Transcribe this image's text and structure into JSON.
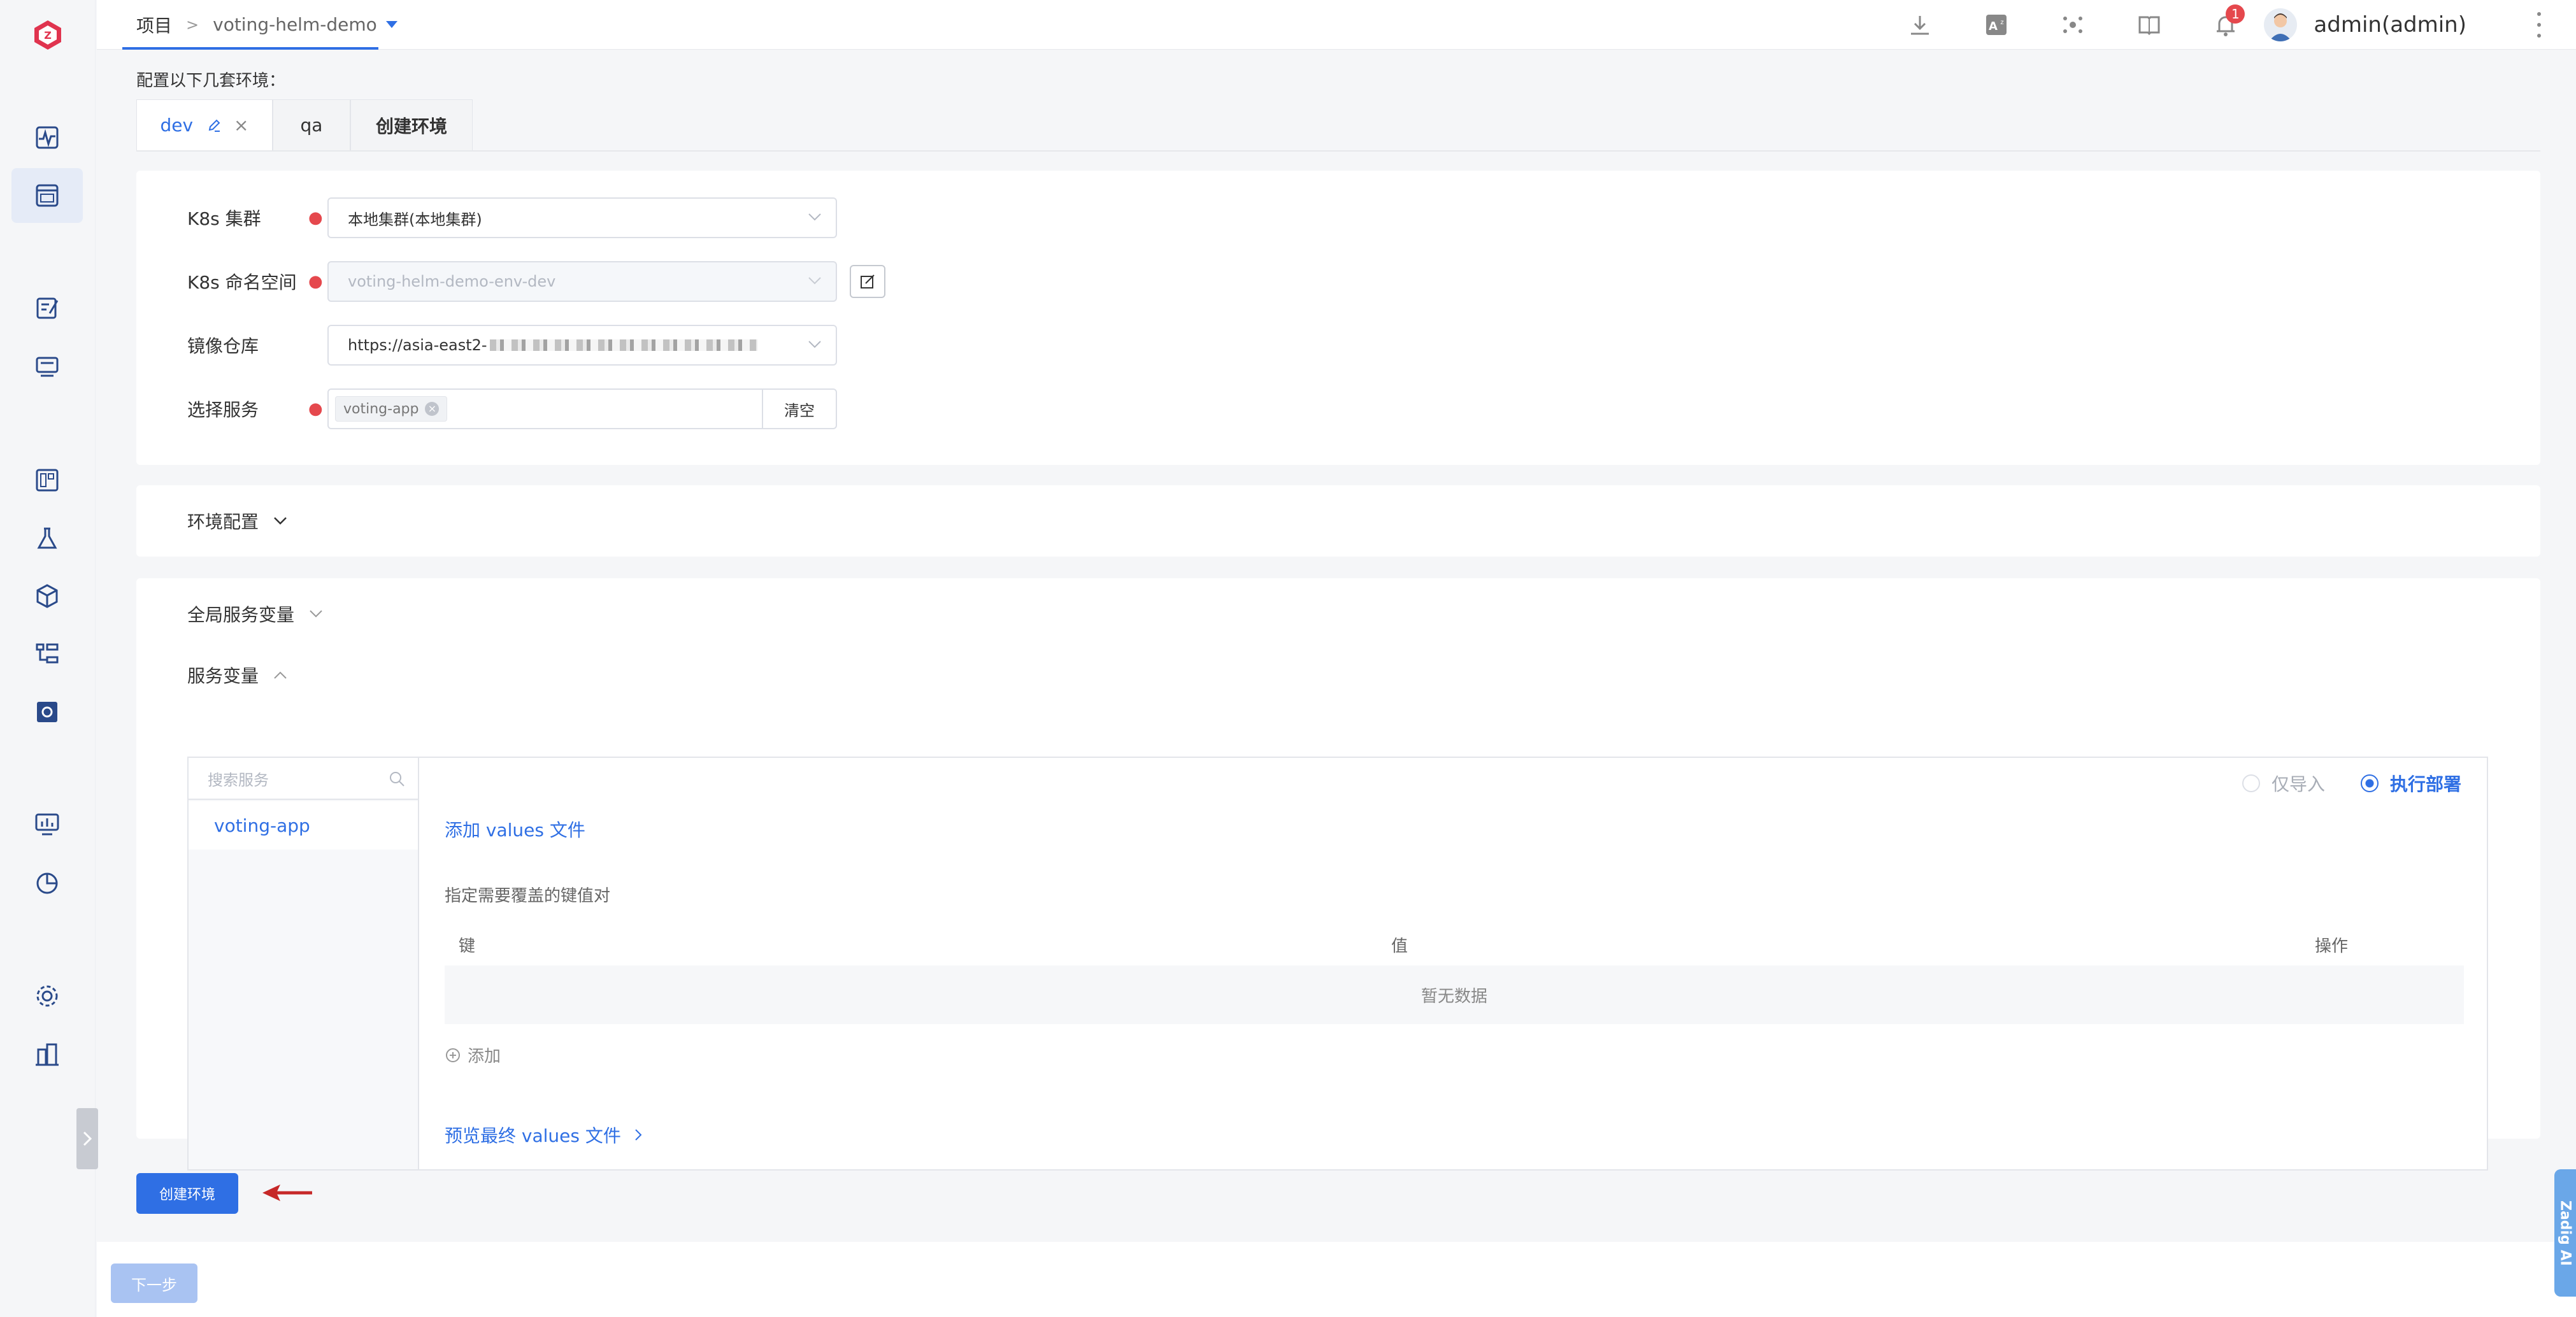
{
  "breadcrumb": {
    "root": "项目",
    "separator": ">",
    "project": "voting-helm-demo"
  },
  "header": {
    "user": "admin(admin)",
    "notification_count": "1"
  },
  "env_hint": "配置以下几套环境：",
  "tabs": [
    {
      "label": "dev"
    },
    {
      "label": "qa"
    },
    {
      "label": "创建环境"
    }
  ],
  "form": {
    "cluster_label": "K8s 集群",
    "cluster_value": "本地集群(本地集群)",
    "namespace_label": "K8s 命名空间",
    "namespace_value": "voting-helm-demo-env-dev",
    "registry_label": "镜像仓库",
    "registry_value": "https://asia-east2-",
    "service_label": "选择服务",
    "service_tag": "voting-app",
    "clear_label": "清空"
  },
  "env_config": {
    "title": "环境配置"
  },
  "vars": {
    "global_title": "全局服务变量",
    "service_title": "服务变量",
    "search_placeholder": "搜索服务",
    "services": [
      "voting-app"
    ],
    "radio_import": "仅导入",
    "radio_deploy": "执行部署",
    "add_values_file": "添加 values 文件",
    "kv_hint": "指定需要覆盖的键值对",
    "col_key": "键",
    "col_value": "值",
    "col_action": "操作",
    "empty": "暂无数据",
    "add": "添加",
    "preview": "预览最终 values 文件"
  },
  "actions": {
    "create_env": "创建环境",
    "next": "下一步",
    "ai": "Zadig AI"
  },
  "colors": {
    "primary": "#2f6fe4",
    "required": "#e5484d",
    "arrow": "#c62828",
    "brand": "#e0344f"
  }
}
